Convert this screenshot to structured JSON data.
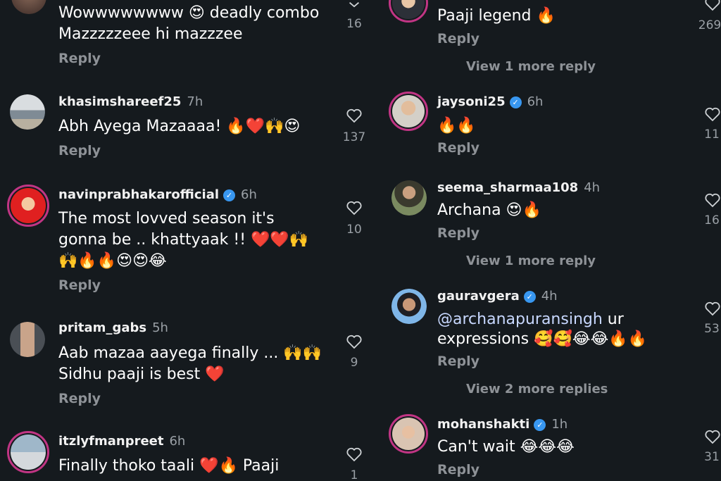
{
  "left": [
    {
      "text_lines": [
        "Wowwwwwwww 😍 deadly combo",
        "Mazzzzzeee hi mazzzee"
      ],
      "reply": "Reply",
      "likes": "16"
    },
    {
      "username": "khasimshareef25",
      "time": "7h",
      "verified": false,
      "text_lines": [
        "Abh Ayega Mazaaaa! 🔥❤️🙌😍"
      ],
      "reply": "Reply",
      "likes": "137"
    },
    {
      "username": "navinprabhakarofficial",
      "time": "6h",
      "verified": true,
      "text_lines": [
        "The most lovved season it's",
        "gonna be .. khattyaak !! ❤️❤️🙌",
        "🙌🔥🔥😍😍😂"
      ],
      "reply": "Reply",
      "likes": "10"
    },
    {
      "username": "pritam_gabs",
      "time": "5h",
      "verified": false,
      "text_lines": [
        "Aab mazaa aayega finally ... 🙌🙌",
        "Sidhu paaji is best ❤️"
      ],
      "reply": "Reply",
      "likes": "9"
    },
    {
      "username": "itzlyfmanpreet",
      "time": "6h",
      "verified": false,
      "text_lines": [
        "Finally thoko taali ❤️🔥 Paaji"
      ],
      "likes": "1"
    }
  ],
  "right": [
    {
      "text_lines": [
        "Paaji legend 🔥"
      ],
      "reply": "Reply",
      "likes": "269",
      "more": "View 1 more reply"
    },
    {
      "username": "jaysoni25",
      "time": "6h",
      "verified": true,
      "text_lines": [
        "🔥🔥"
      ],
      "reply": "Reply",
      "likes": "11"
    },
    {
      "username": "seema_sharmaa108",
      "time": "4h",
      "verified": false,
      "text_lines": [
        "Archana 😍🔥"
      ],
      "reply": "Reply",
      "likes": "16",
      "more": "View 1 more reply"
    },
    {
      "username": "gauravgera",
      "time": "4h",
      "verified": true,
      "mention": "@archanapuransingh",
      "mention_rest": " ur",
      "text_lines": [
        "expressions 🥰🥰😂😂🔥🔥"
      ],
      "reply": "Reply",
      "likes": "53",
      "more": "View 2 more replies"
    },
    {
      "username": "mohanshakti",
      "time": "1h",
      "verified": true,
      "text_lines": [
        "Can't wait 😂😂😂"
      ],
      "reply": "Reply",
      "likes": "31"
    }
  ],
  "icons": {
    "heart": "heart-outline-icon",
    "verified": "verified-badge-icon"
  },
  "colors": {
    "background": "#151a1e",
    "muted": "#8e9297",
    "verified": "#3897f0",
    "heart_filled": "#ff3040"
  }
}
